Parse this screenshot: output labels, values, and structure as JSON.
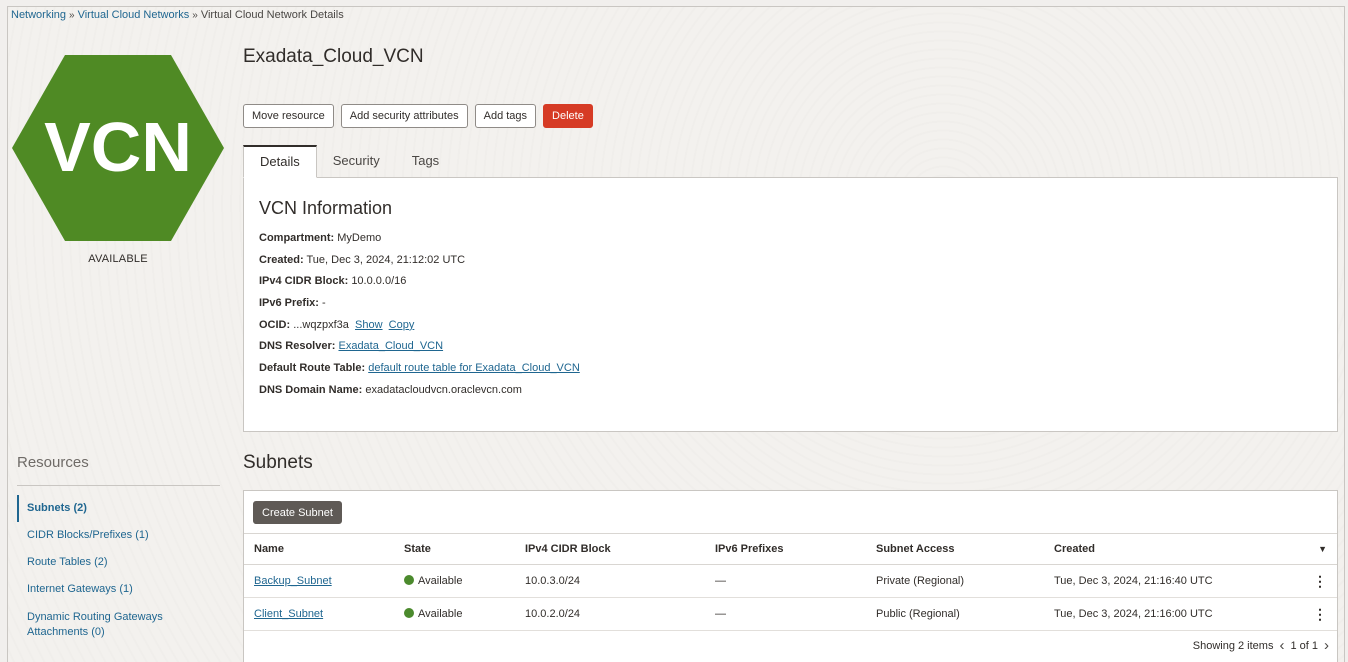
{
  "breadcrumb": {
    "items": [
      "Networking",
      "Virtual Cloud Networks",
      "Virtual Cloud Network Details"
    ],
    "separator": "»"
  },
  "badge": {
    "text": "VCN",
    "color": "#4f8a24",
    "status": "AVAILABLE"
  },
  "resources": {
    "heading": "Resources",
    "items": [
      "Subnets (2)",
      "CIDR Blocks/Prefixes (1)",
      "Route Tables (2)",
      "Internet Gateways (1)",
      "Dynamic Routing Gateways Attachments (0)"
    ]
  },
  "title": "Exadata_Cloud_VCN",
  "actions": {
    "move": "Move resource",
    "security_attrs": "Add security attributes",
    "tags": "Add tags",
    "delete": "Delete"
  },
  "tabs": [
    "Details",
    "Security",
    "Tags"
  ],
  "details": {
    "heading": "VCN Information",
    "compartment_label": "Compartment:",
    "compartment": "MyDemo",
    "created_label": "Created:",
    "created": "Tue, Dec 3, 2024, 21:12:02 UTC",
    "ipv4_label": "IPv4 CIDR Block:",
    "ipv4": "10.0.0.0/16",
    "ipv6_label": "IPv6 Prefix:",
    "ipv6": "-",
    "ocid_label": "OCID:",
    "ocid": "...wqzpxf3a",
    "show": "Show",
    "copy": "Copy",
    "dns_resolver_label": "DNS Resolver:",
    "dns_resolver": "Exadata_Cloud_VCN",
    "route_table_label": "Default Route Table:",
    "route_table": "default route table for Exadata_Cloud_VCN",
    "dns_domain_label": "DNS Domain Name:",
    "dns_domain": "exadatacloudvcn.oraclevcn.com"
  },
  "subnets": {
    "title": "Subnets",
    "create_button": "Create Subnet",
    "columns": [
      "Name",
      "State",
      "IPv4 CIDR Block",
      "IPv6 Prefixes",
      "Subnet Access",
      "Created"
    ],
    "rows": [
      {
        "name": "Backup_Subnet",
        "state": "Available",
        "ipv4": "10.0.3.0/24",
        "ipv6": "—",
        "access": "Private (Regional)",
        "created": "Tue, Dec 3, 2024, 21:16:40 UTC"
      },
      {
        "name": "Client_Subnet",
        "state": "Available",
        "ipv4": "10.0.2.0/24",
        "ipv6": "—",
        "access": "Public (Regional)",
        "created": "Tue, Dec 3, 2024, 21:16:00 UTC"
      }
    ],
    "showing": "Showing 2 items",
    "page": "1 of 1"
  }
}
